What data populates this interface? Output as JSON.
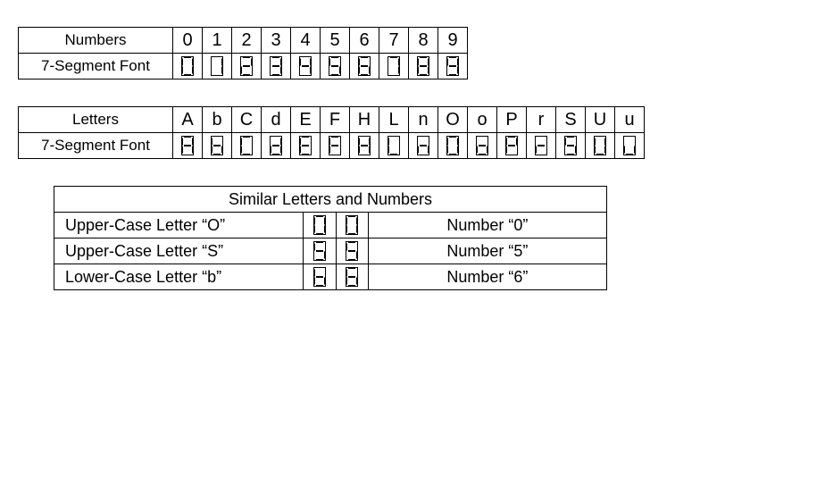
{
  "table1": {
    "row_labels": [
      "Numbers",
      "7-Segment Font"
    ],
    "numbers": [
      "0",
      "1",
      "2",
      "3",
      "4",
      "5",
      "6",
      "7",
      "8",
      "9"
    ],
    "segcodes": [
      "0",
      "1",
      "2",
      "3",
      "4",
      "5",
      "6",
      "7",
      "8",
      "9"
    ]
  },
  "table2": {
    "row_labels": [
      "Letters",
      "7-Segment Font"
    ],
    "letters": [
      "A",
      "b",
      "C",
      "d",
      "E",
      "F",
      "H",
      "L",
      "n",
      "O",
      "o",
      "P",
      "r",
      "S",
      "U",
      "u"
    ],
    "segcodes": [
      "A",
      "b",
      "C",
      "d",
      "E",
      "F",
      "H",
      "L",
      "n",
      "O",
      "o",
      "P",
      "r",
      "S",
      "U",
      "u"
    ]
  },
  "table3": {
    "header": "Similar Letters and Numbers",
    "rows": [
      {
        "left": "Upper-Case Letter “O”",
        "seg1": "O",
        "seg2": "0",
        "right": "Number “0”"
      },
      {
        "left": "Upper-Case Letter “S”",
        "seg1": "S",
        "seg2": "5",
        "right": "Number “5”"
      },
      {
        "left": "Lower-Case Letter “b”",
        "seg1": "b",
        "seg2": "6",
        "right": "Number “6”"
      }
    ]
  }
}
